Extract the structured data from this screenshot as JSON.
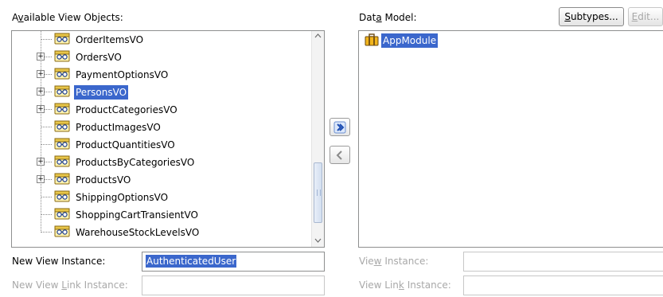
{
  "labels": {
    "available_prefix": "A",
    "available_mnemonic": "v",
    "available_rest": "ailable View Objects:",
    "data_model_prefix": "Dat",
    "data_model_mnemonic": "a",
    "data_model_rest": " Model:",
    "new_view_instance": "New View Instance:",
    "nvli_prefix": "New View ",
    "nvli_mnemonic": "L",
    "nvli_rest": "ink Instance:",
    "vi_prefix": "Vie",
    "vi_mnemonic": "w",
    "vi_rest": " Instance:",
    "vli_prefix": "View Lin",
    "vli_mnemonic": "k",
    "vli_rest": " Instance:"
  },
  "buttons": {
    "subtypes_mnemonic": "S",
    "subtypes_rest": "ubtypes...",
    "edit_mnemonic": "E",
    "edit_rest": "dit..."
  },
  "tree": {
    "items": [
      {
        "label": "OrderItemsVO",
        "expandable": false,
        "selected": false
      },
      {
        "label": "OrdersVO",
        "expandable": true,
        "selected": false
      },
      {
        "label": "PaymentOptionsVO",
        "expandable": true,
        "selected": false
      },
      {
        "label": "PersonsVO",
        "expandable": true,
        "selected": true
      },
      {
        "label": "ProductCategoriesVO",
        "expandable": true,
        "selected": false
      },
      {
        "label": "ProductImagesVO",
        "expandable": false,
        "selected": false
      },
      {
        "label": "ProductQuantitiesVO",
        "expandable": false,
        "selected": false
      },
      {
        "label": "ProductsByCategoriesVO",
        "expandable": true,
        "selected": false
      },
      {
        "label": "ProductsVO",
        "expandable": true,
        "selected": false
      },
      {
        "label": "ShippingOptionsVO",
        "expandable": false,
        "selected": false
      },
      {
        "label": "ShoppingCartTransientVO",
        "expandable": false,
        "selected": false
      },
      {
        "label": "WarehouseStockLevelsVO",
        "expandable": false,
        "selected": false
      }
    ]
  },
  "data_model": {
    "root_label": "AppModule"
  },
  "fields": {
    "new_view_instance_value": "AuthenticatedUser",
    "new_view_link_instance_value": "",
    "view_instance_value": "",
    "view_link_instance_value": ""
  },
  "icons": {
    "view_object": "view-object-icon",
    "app_module": "app-module-icon",
    "add": "shuttle-right-icon",
    "remove": "shuttle-left-icon",
    "expand": "plus-icon"
  },
  "colors": {
    "selection": "#3b67cc",
    "accent_blue": "#2f62c9"
  }
}
